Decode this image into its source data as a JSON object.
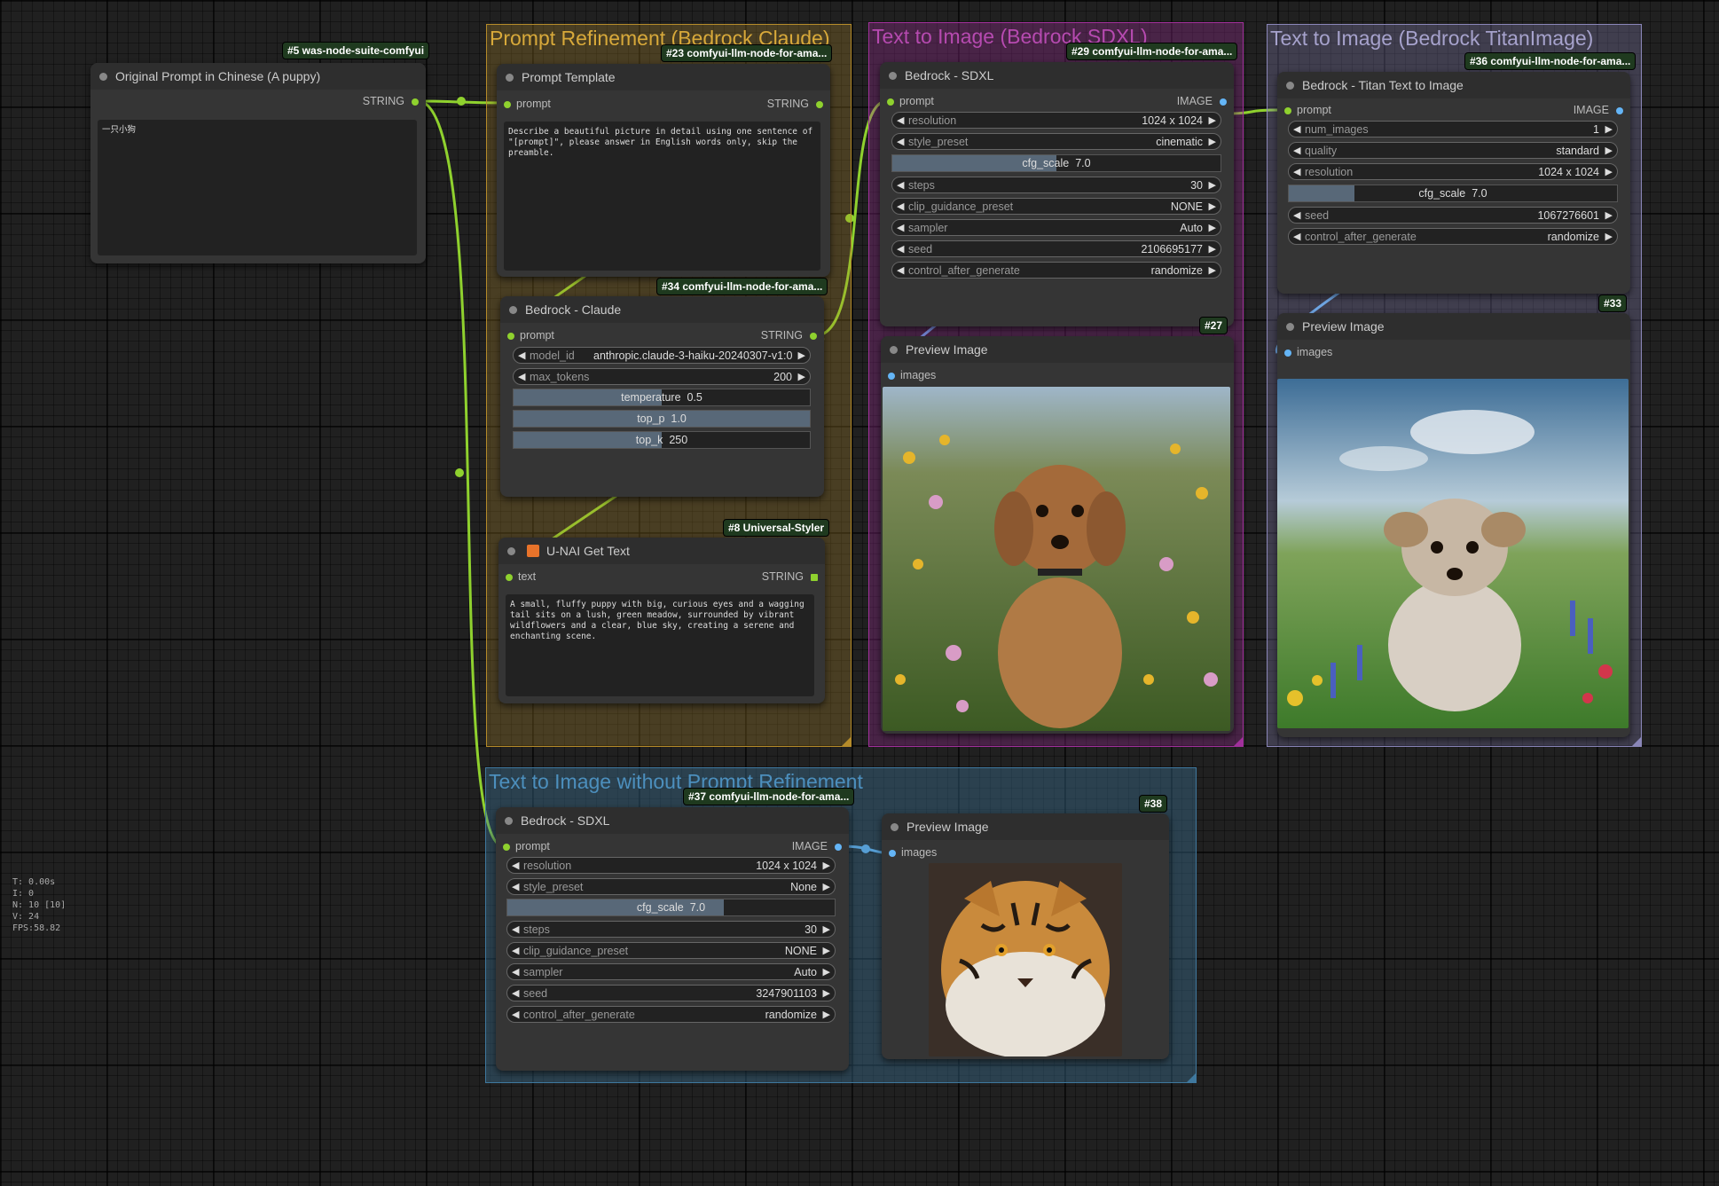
{
  "groups": {
    "prompt_refinement": "Prompt Refinement (Bedrock Claude)",
    "t2i_sdxl": "Text to Image (Bedrock SDXL)",
    "t2i_titan": "Text to Image (Bedrock TitanImage)",
    "t2i_no_refine": "Text to Image without Prompt Refinement"
  },
  "nodes": {
    "original_prompt": {
      "badge": "#5 was-node-suite-comfyui",
      "title": "Original Prompt in Chinese (A puppy)",
      "out": "STRING",
      "text": "一只小狗"
    },
    "prompt_template": {
      "badge": "#23 comfyui-llm-node-for-ama...",
      "title": "Prompt Template",
      "in": "prompt",
      "out": "STRING",
      "text": "Describe a beautiful picture in detail using one sentence of \"[prompt]\", please answer in English words only, skip the preamble."
    },
    "bedrock_claude": {
      "badge": "#34 comfyui-llm-node-for-ama...",
      "title": "Bedrock - Claude",
      "in": "prompt",
      "out": "STRING",
      "model_id_name": "model_id",
      "model_id": "anthropic.claude-3-haiku-20240307-v1:0",
      "max_tokens_name": "max_tokens",
      "max_tokens": "200",
      "temperature_label": "temperature",
      "temperature": "0.5",
      "temperature_frac": 0.5,
      "top_p_label": "top_p",
      "top_p": "1.0",
      "top_p_frac": 1.0,
      "top_k_label": "top_k",
      "top_k": "250",
      "top_k_frac": 0.5
    },
    "get_text": {
      "badge": "#8 Universal-Styler",
      "title": "U-NAI Get Text",
      "in": "text",
      "out": "STRING",
      "text": "A small, fluffy puppy with big, curious eyes and a wagging tail sits on a lush, green meadow, surrounded by vibrant wildflowers and a clear, blue sky, creating a serene and enchanting scene."
    },
    "sdxl_top": {
      "badge": "#29 comfyui-llm-node-for-ama...",
      "title": "Bedrock - SDXL",
      "in": "prompt",
      "out": "IMAGE",
      "widgets": [
        {
          "name": "resolution",
          "value": "1024 x 1024"
        },
        {
          "name": "style_preset",
          "value": "cinematic"
        }
      ],
      "cfg_label": "cfg_scale",
      "cfg": "7.0",
      "cfg_frac": 0.5,
      "widgets2": [
        {
          "name": "steps",
          "value": "30"
        },
        {
          "name": "clip_guidance_preset",
          "value": "NONE"
        },
        {
          "name": "sampler",
          "value": "Auto"
        },
        {
          "name": "seed",
          "value": "2106695177"
        },
        {
          "name": "control_after_generate",
          "value": "randomize"
        }
      ]
    },
    "preview_27": {
      "badge": "#27",
      "title": "Preview Image",
      "in": "images"
    },
    "titan": {
      "badge": "#36 comfyui-llm-node-for-ama...",
      "title": "Bedrock - Titan Text to Image",
      "in": "prompt",
      "out": "IMAGE",
      "widgets": [
        {
          "name": "num_images",
          "value": "1"
        },
        {
          "name": "quality",
          "value": "standard"
        },
        {
          "name": "resolution",
          "value": "1024 x 1024"
        }
      ],
      "cfg_label": "cfg_scale",
      "cfg": "7.0",
      "cfg_frac": 0.2,
      "widgets2": [
        {
          "name": "seed",
          "value": "1067276601"
        },
        {
          "name": "control_after_generate",
          "value": "randomize"
        }
      ]
    },
    "preview_33": {
      "badge": "#33",
      "title": "Preview Image",
      "in": "images"
    },
    "sdxl_bottom": {
      "badge": "#37 comfyui-llm-node-for-ama...",
      "title": "Bedrock - SDXL",
      "in": "prompt",
      "out": "IMAGE",
      "widgets": [
        {
          "name": "resolution",
          "value": "1024 x 1024"
        },
        {
          "name": "style_preset",
          "value": "None"
        }
      ],
      "cfg_label": "cfg_scale",
      "cfg": "7.0",
      "cfg_frac": 0.66,
      "widgets2": [
        {
          "name": "steps",
          "value": "30"
        },
        {
          "name": "clip_guidance_preset",
          "value": "NONE"
        },
        {
          "name": "sampler",
          "value": "Auto"
        },
        {
          "name": "seed",
          "value": "3247901103"
        },
        {
          "name": "control_after_generate",
          "value": "randomize"
        }
      ]
    },
    "preview_38": {
      "badge": "#38",
      "title": "Preview Image",
      "in": "images"
    }
  },
  "stats": {
    "t": "T: 0.00s",
    "i": "I: 0",
    "n": "N: 10 [10]",
    "v": "V: 24",
    "fps": "FPS:58.82"
  },
  "colors": {
    "string_wire": "#8fd12e",
    "image_wire": "#64b5f6",
    "group_yellow": "#b58b2a",
    "group_purple": "#a1309b",
    "group_lavender": "#8a86b8",
    "group_blue": "#3f789e"
  },
  "icons": {
    "get_text": "unai-emoji-icon"
  }
}
